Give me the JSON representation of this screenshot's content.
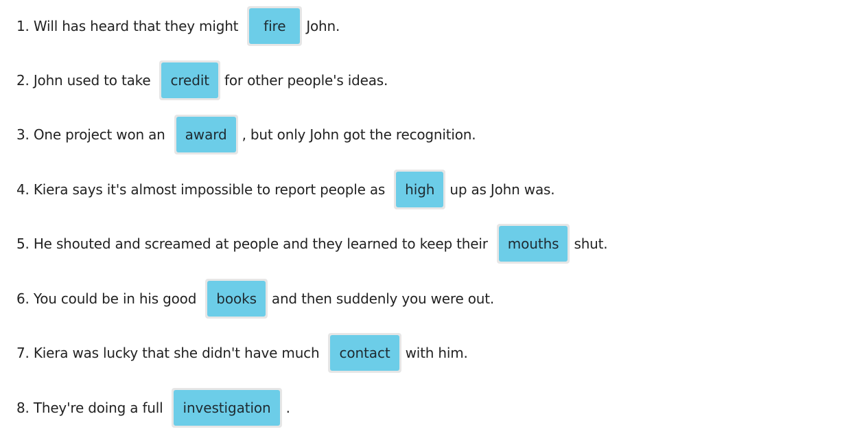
{
  "exercise": {
    "items": [
      {
        "before": "1. Will has heard that they might",
        "answer": "fire",
        "after": "John."
      },
      {
        "before": "2. John used to take",
        "answer": "credit",
        "after": "for other people's ideas."
      },
      {
        "before": "3. One project won an",
        "answer": "award",
        "after": ", but only John got the recognition."
      },
      {
        "before": "4. Kiera says it's almost impossible to report people as",
        "answer": "high",
        "after": "up as John was."
      },
      {
        "before": "5. He shouted and screamed at people and they learned to keep their",
        "answer": "mouths",
        "after": "shut."
      },
      {
        "before": "6. You could be in his good",
        "answer": "books",
        "after": "and then suddenly you were out."
      },
      {
        "before": "7. Kiera was lucky that she didn't have much",
        "answer": "contact",
        "after": "with him."
      },
      {
        "before": "8. They're doing a full",
        "answer": "investigation",
        "after": "."
      }
    ]
  },
  "colors": {
    "chip": "#6ccde8",
    "slot_border": "#e6e6e6",
    "text": "#222222"
  }
}
